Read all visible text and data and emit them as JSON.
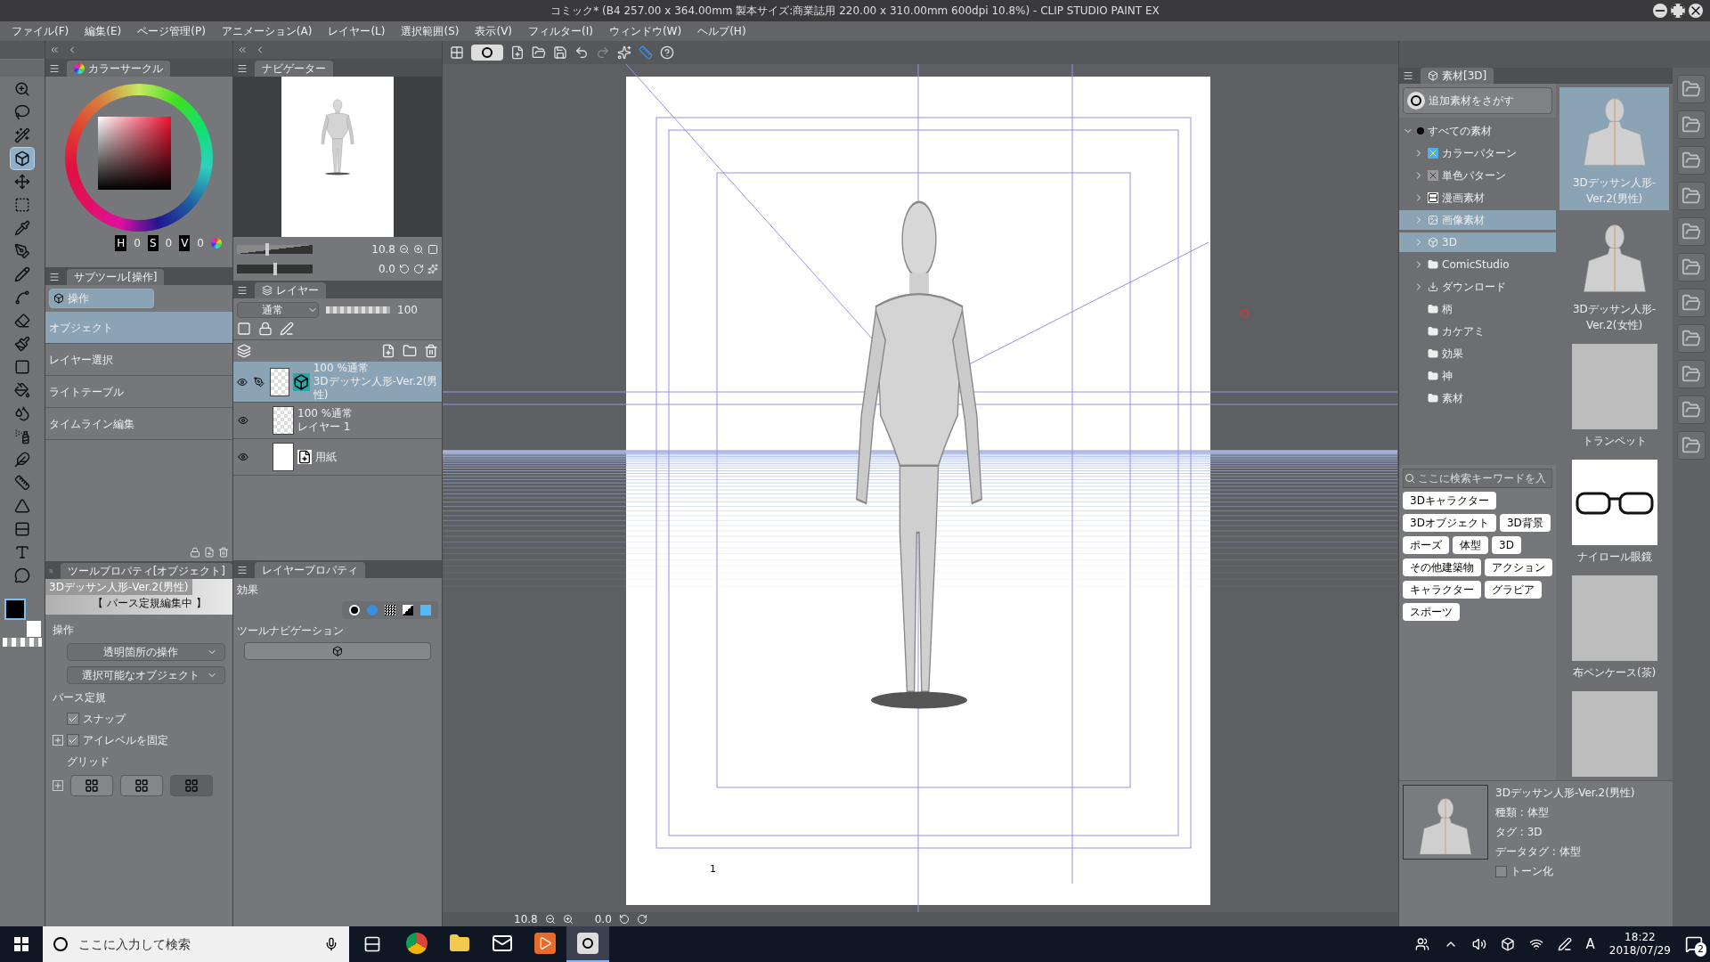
{
  "window": {
    "title": "コミック* (B4 257.00 x 364.00mm 製本サイズ:商業誌用 220.00 x 310.00mm 600dpi 10.8%) - CLIP STUDIO PAINT EX"
  },
  "menu": [
    "ファイル(F)",
    "編集(E)",
    "ページ管理(P)",
    "アニメーション(A)",
    "レイヤー(L)",
    "選択範囲(S)",
    "表示(V)",
    "フィルター(I)",
    "ウィンドウ(W)",
    "ヘルプ(H)"
  ],
  "tools": [
    {
      "kind": "zoom",
      "selected": false
    },
    {
      "kind": "lasso",
      "selected": false
    },
    {
      "kind": "wand",
      "selected": false
    },
    {
      "kind": "object",
      "selected": true
    },
    {
      "kind": "move",
      "selected": false
    },
    {
      "kind": "selection",
      "selected": false
    },
    {
      "kind": "eyedropper",
      "selected": false
    },
    {
      "kind": "pen",
      "selected": false
    },
    {
      "kind": "pencil",
      "selected": false
    },
    {
      "kind": "curve",
      "selected": false
    },
    {
      "kind": "eraser",
      "selected": false
    },
    {
      "kind": "pattern",
      "selected": false
    },
    {
      "kind": "gradient",
      "selected": false
    },
    {
      "kind": "bucket",
      "selected": false
    },
    {
      "kind": "blend",
      "selected": false
    },
    {
      "kind": "airbrush",
      "selected": false
    },
    {
      "kind": "decoration",
      "selected": false
    },
    {
      "kind": "ruler",
      "selected": false
    },
    {
      "kind": "triangle",
      "selected": false
    },
    {
      "kind": "frame",
      "selected": false
    },
    {
      "kind": "text",
      "selected": false
    },
    {
      "kind": "balloon",
      "selected": false
    }
  ],
  "color_circle": {
    "tab": "カラーサークル",
    "channels": [
      {
        "label": "H",
        "value": "0"
      },
      {
        "label": "S",
        "value": "0"
      },
      {
        "label": "V",
        "value": "0"
      }
    ]
  },
  "navigator": {
    "tab": "ナビゲーター",
    "zoom": "10.8",
    "rotation": "0.0",
    "zoom_slider": {
      "level": 0.4
    },
    "rotation_slider": {
      "level": 0.5
    }
  },
  "sub_tool": {
    "tab": "サブツール[操作]",
    "group": "操作",
    "items": [
      {
        "label": "オブジェクト",
        "selected": true
      },
      {
        "label": "レイヤー選択",
        "selected": false
      },
      {
        "label": "ライトテーブル",
        "selected": false
      },
      {
        "label": "タイムライン編集",
        "selected": false
      }
    ]
  },
  "layers": {
    "tab": "レイヤー",
    "blend_mode": "通常",
    "opacity": "100",
    "opacity_level": {
      "level": 1
    },
    "items": [
      {
        "kind": "model",
        "mode": "100 %通常",
        "name": "3Dデッサン人形-Ver.2(男性)",
        "selected": true,
        "visible": true
      },
      {
        "kind": "raster",
        "mode": "100 %通常",
        "name": "レイヤー 1",
        "selected": false,
        "visible": true
      },
      {
        "kind": "paper",
        "name": "用紙",
        "selected": false,
        "visible": true
      }
    ]
  },
  "tool_property": {
    "tab": "ツールプロパティ[オブジェクト]",
    "object_name": "3Dデッサン人形-Ver.2(男性)",
    "status": "【 パース定規編集中 】",
    "operation": {
      "heading": "操作",
      "dropdowns": [
        "透明箇所の操作",
        "選択可能なオブジェクト"
      ]
    },
    "perspective": {
      "heading": "パース定規",
      "options": [
        {
          "label": "スナップ",
          "checked": true,
          "expandable": false
        },
        {
          "label": "アイレベルを固定",
          "checked": true,
          "expandable": true
        }
      ]
    },
    "grid": {
      "heading": "グリッド",
      "buttons": [
        {
          "selected": false
        },
        {
          "selected": false
        },
        {
          "selected": true
        }
      ]
    }
  },
  "layer_property": {
    "tab": "レイヤープロパティ",
    "effect": "効果",
    "tool_navigation": "ツールナビゲーション"
  },
  "canvas": {
    "zoom": "10.8",
    "rotation": "0.0",
    "page_number": "1"
  },
  "materials": {
    "tab": "素材[3D]",
    "search_more": "追加素材をさがす",
    "tree": [
      {
        "label": "すべての素材",
        "expanded": true,
        "selected": false,
        "children": [
          {
            "label": "カラーパターン",
            "kind": "pattern",
            "has_children": true,
            "selected": false
          },
          {
            "label": "単色パターン",
            "kind": "mono",
            "has_children": true,
            "selected": false
          },
          {
            "label": "漫画素材",
            "kind": "manga",
            "has_children": true,
            "selected": false
          },
          {
            "label": "画像素材",
            "kind": "image",
            "has_children": true,
            "selected": true
          },
          {
            "label": "3D",
            "kind": "model",
            "has_children": true,
            "selected": true
          },
          {
            "label": "ComicStudio",
            "kind": "folder",
            "has_children": true,
            "selected": false
          },
          {
            "label": "ダウンロード",
            "kind": "download",
            "has_children": true,
            "selected": false
          },
          {
            "label": "柄",
            "kind": "folder",
            "has_children": false,
            "selected": false
          },
          {
            "label": "カケアミ",
            "kind": "folder",
            "has_children": false,
            "selected": false
          },
          {
            "label": "効果",
            "kind": "folder",
            "has_children": false,
            "selected": false
          },
          {
            "label": "神",
            "kind": "folder",
            "has_children": false,
            "selected": false
          },
          {
            "label": "素材",
            "kind": "folder",
            "has_children": false,
            "selected": false
          }
        ]
      }
    ],
    "search_placeholder": "ここに検索キーワードを入",
    "tags": [
      "3Dキャラクター",
      "3Dオブジェクト",
      "3D背景",
      "ポーズ",
      "体型",
      "3D",
      "その他建築物",
      "アクション",
      "キャラクター",
      "グラビア",
      "スポーツ"
    ],
    "items": [
      {
        "kind": "figure",
        "label": "3Dデッサン人形-Ver.2(男性)",
        "selected": true
      },
      {
        "kind": "figure",
        "label": "3Dデッサン人形-Ver.2(女性)",
        "selected": false
      },
      {
        "kind": "photo",
        "label": "トランペット",
        "selected": false
      },
      {
        "kind": "glasses",
        "label": "ナイロール眼鏡",
        "selected": false
      },
      {
        "kind": "photo",
        "label": "布ペンケース(茶)",
        "selected": false
      },
      {
        "kind": "photo",
        "selected": false
      }
    ],
    "detail": {
      "name": "3Dデッサン人形-Ver.2(男性)",
      "lines": [
        "種類 : 体型",
        "タグ : 3D",
        "データタグ : 体型"
      ],
      "tone": {
        "label": "トーン化",
        "checked": false
      }
    }
  },
  "taskbar": {
    "search_placeholder": "ここに入力して検索",
    "apps": [
      {
        "kind": "chrome",
        "selected": false
      },
      {
        "kind": "folder",
        "selected": false
      },
      {
        "kind": "mail",
        "selected": false
      },
      {
        "kind": "media",
        "selected": false
      },
      {
        "kind": "paint",
        "selected": true
      }
    ],
    "ime": "A",
    "time": "18:22",
    "date": "2018/07/29",
    "notifications": "2"
  }
}
